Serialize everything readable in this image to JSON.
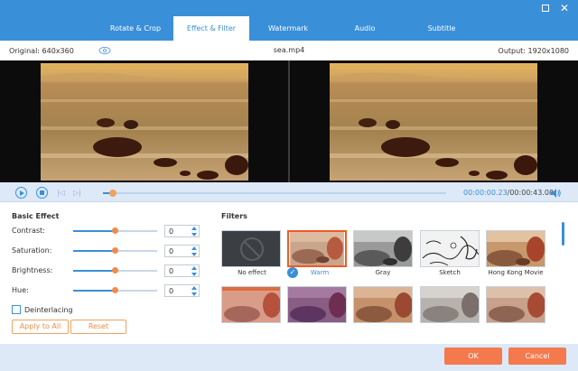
{
  "tabs": [
    {
      "label": "Rotate & Crop",
      "active": false
    },
    {
      "label": "Effect & Filter",
      "active": true
    },
    {
      "label": "Watermark",
      "active": false
    },
    {
      "label": "Audio",
      "active": false
    },
    {
      "label": "Subtitle",
      "active": false
    }
  ],
  "info": {
    "original": "Original: 640x360",
    "filename": "sea.mp4",
    "output": "Output: 1920x1080"
  },
  "playback": {
    "current_time": "00:00:00.23",
    "total_time": "/00:00:43.08",
    "progress_fraction": 0.03
  },
  "basic_effect": {
    "title": "Basic Effect",
    "rows": [
      {
        "label": "Contrast:",
        "value": "0",
        "level": 0.5
      },
      {
        "label": "Saturation:",
        "value": "0",
        "level": 0.5
      },
      {
        "label": "Brightness:",
        "value": "0",
        "level": 0.5
      },
      {
        "label": "Hue:",
        "value": "0",
        "level": 0.5
      }
    ],
    "deinterlacing_label": "Deinterlacing",
    "deinterlacing_checked": false,
    "apply_all_label": "Apply to All",
    "reset_label": "Reset"
  },
  "filters": {
    "title": "Filters",
    "items": [
      {
        "label": "No effect",
        "style": "none"
      },
      {
        "label": "Warm",
        "style": "warm",
        "selected": true
      },
      {
        "label": "Gray",
        "style": "gray"
      },
      {
        "label": "Sketch",
        "style": "sketch"
      },
      {
        "label": "Hong Kong Movie",
        "style": "hk"
      },
      {
        "label": "",
        "style": "pink"
      },
      {
        "label": "",
        "style": "purple"
      },
      {
        "label": "",
        "style": "orange"
      },
      {
        "label": "",
        "style": "cool"
      },
      {
        "label": "",
        "style": "natural"
      }
    ]
  },
  "footer": {
    "ok_label": "OK",
    "cancel_label": "Cancel"
  },
  "colors": {
    "accent": "#3a8fd9",
    "orange": "#f47a4e"
  }
}
